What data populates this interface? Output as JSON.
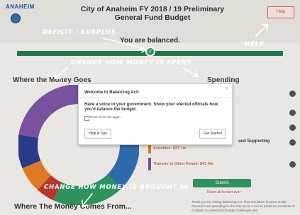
{
  "header": {
    "logo_text": "ANAHEIM",
    "title_line1": "City of Anaheim FY 2018 / 19 Preliminary",
    "title_line2": "General Fund Budget",
    "help_label": "Help"
  },
  "balance_status": "You are balanced.",
  "annotations": {
    "deficit_surplus": "Deficit / Surplus",
    "help": "Help",
    "change_spent": "Change how money is spent",
    "change_brought_in": "Change how money is brought in"
  },
  "sections": {
    "where_money_goes": "Where the Money Goes",
    "spending": "Spending",
    "where_money_comes_from": "Where The Money Comes From..."
  },
  "spending_rows": [
    {
      "label": "and Supporting"
    },
    {
      "label": "Activities: $37.7m"
    },
    {
      "label": "Transfer to Other Funds: $47.4m"
    }
  ],
  "submit_label": "Submit",
  "reset_label": "Reset all to start over",
  "footer_note": "Thank you for visiting Balancing Act. This simulation focuses on the General Fund spending for the City and is a tool to assist the residents of Anaheim to understand budget challenges and",
  "modal": {
    "title": "Welcome to Balancing Act!",
    "close": "×",
    "message": "Have a voice in your government. Show your elected officials how you'd balance the budget.",
    "checkbox_label": "Don't show this again",
    "tips_button": "Help & Tips",
    "start_button": "Get Started"
  },
  "colors": {
    "bar_green": "#207e4d",
    "submit_green": "#2f9a60",
    "annotation_white": "#ffffff"
  },
  "donut_segments": [
    {
      "color": "#2f6fb3",
      "value": 0.33
    },
    {
      "color": "#2f9a60",
      "value": 0.19
    },
    {
      "color": "#c0392b",
      "value": 0.05
    },
    {
      "color": "#e67e22",
      "value": 0.07
    },
    {
      "color": "#2b3e8c",
      "value": 0.09
    },
    {
      "color": "#7d55a6",
      "value": 0.27
    }
  ]
}
